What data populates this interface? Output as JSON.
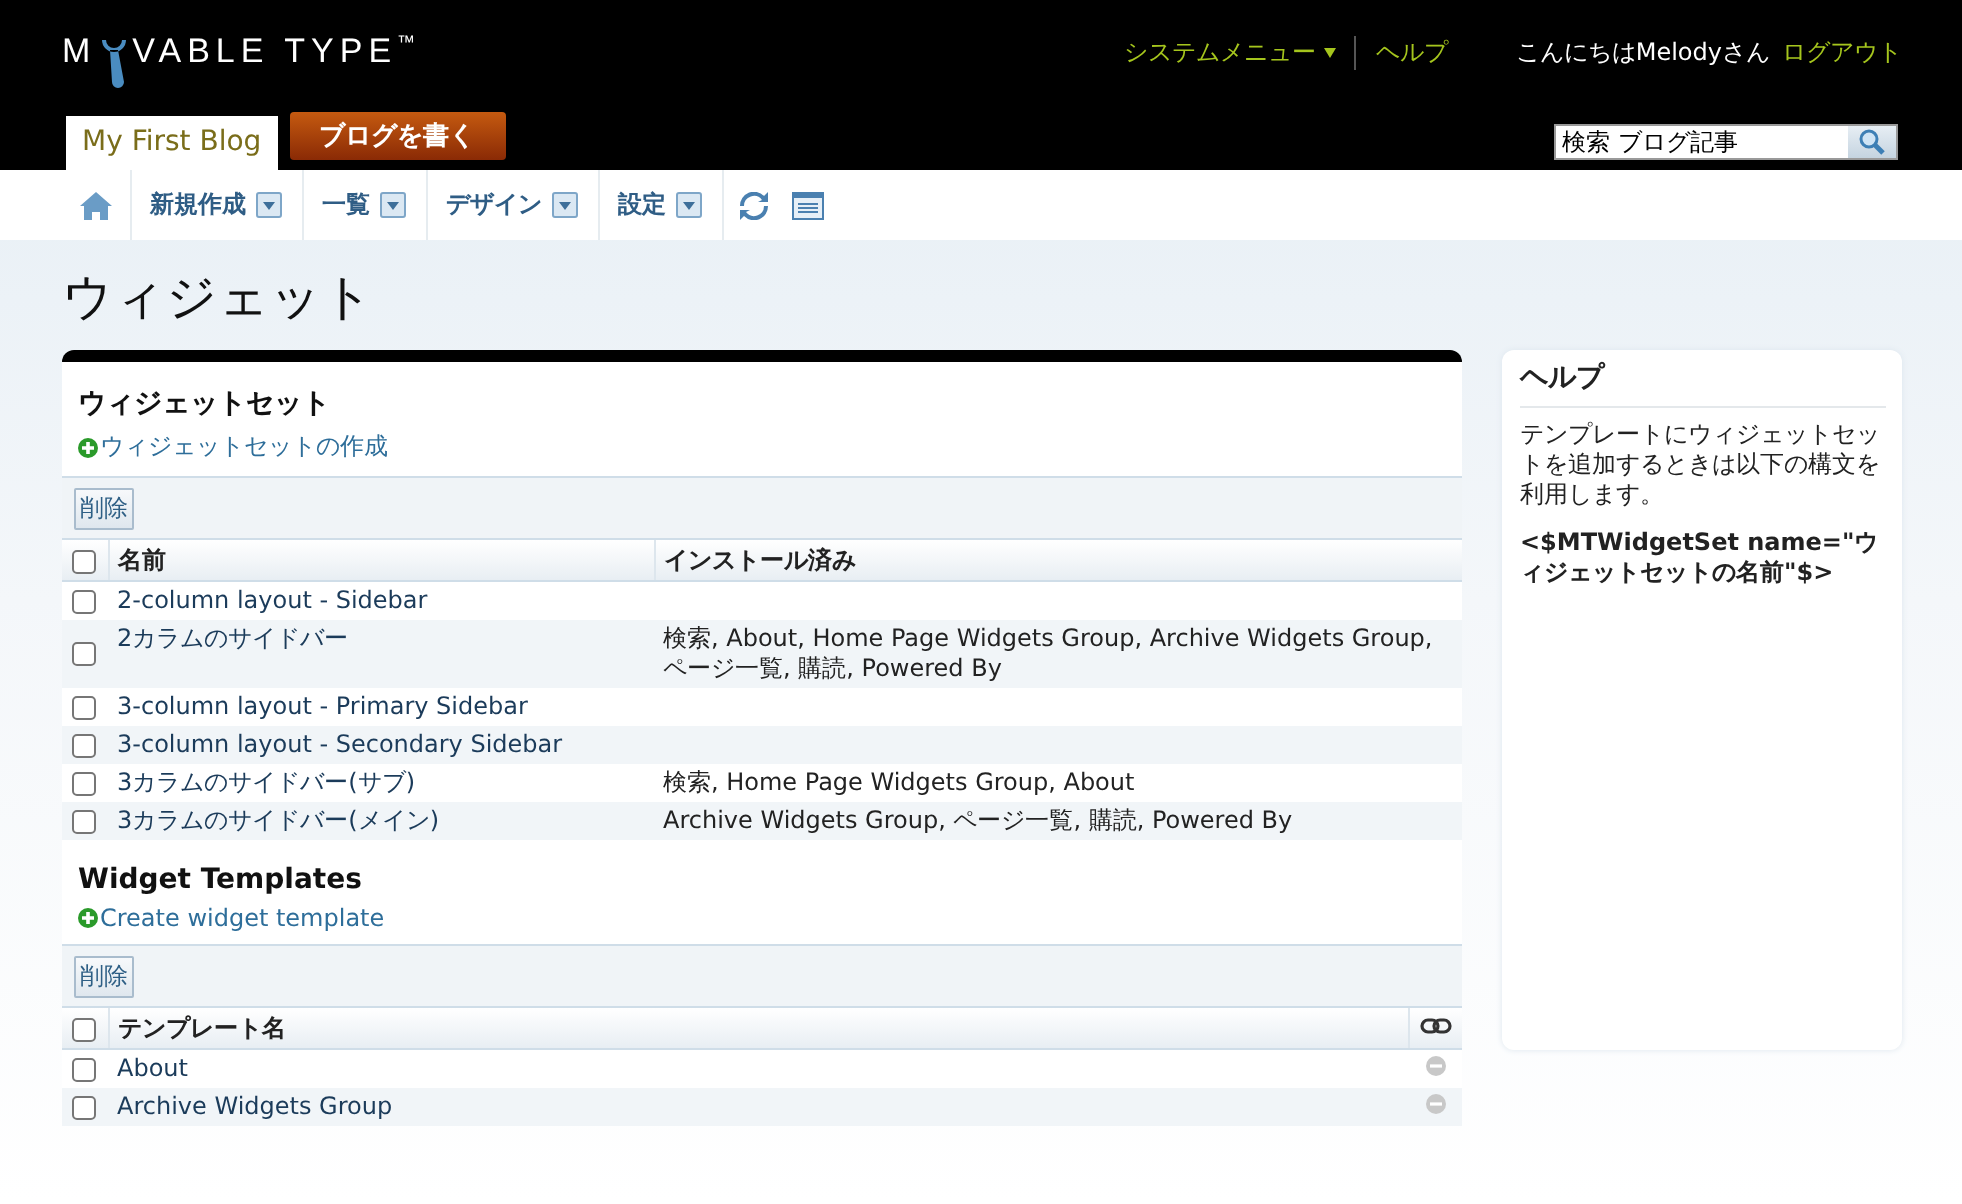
{
  "header": {
    "logo": {
      "before": "M",
      "after": "VABLE TYPE",
      "trademark": "™"
    },
    "system_menu": "システムメニュー",
    "help_link": "ヘルプ",
    "greeting": "こんにちはMelodyさん",
    "logout": "ログアウト",
    "blog_tab": {
      "label": "My First Blog",
      "selected": true
    },
    "write_button": "ブログを書く",
    "search": {
      "value": "検索 ブログ記事"
    }
  },
  "nav": [
    {
      "kind": "home"
    },
    {
      "kind": "menu",
      "label": "新規作成"
    },
    {
      "kind": "menu",
      "label": "一覧"
    },
    {
      "kind": "menu",
      "label": "デザイン"
    },
    {
      "kind": "menu",
      "label": "設定"
    },
    {
      "kind": "refresh"
    },
    {
      "kind": "view"
    }
  ],
  "page_title": "ウィジェット",
  "sections": [
    {
      "kind": "sets",
      "title": "ウィジェットセット",
      "create_link": "ウィジェットセットの作成",
      "delete_button": "削除",
      "columns": [
        "名前",
        "インストール済み"
      ],
      "header_checked": false,
      "rows": [
        {
          "name": "2-column layout - Sidebar",
          "installed": "",
          "checked": false
        },
        {
          "name": "2カラムのサイドバー",
          "installed": "検索, About, Home Page Widgets Group, Archive Widgets Group, ページ一覧, 購読, Powered By",
          "checked": false
        },
        {
          "name": "3-column layout - Primary Sidebar",
          "installed": "",
          "checked": false
        },
        {
          "name": "3-column layout - Secondary Sidebar",
          "installed": "",
          "checked": false
        },
        {
          "name": "3カラムのサイドバー(サブ)",
          "installed": "検索, Home Page Widgets Group, About",
          "checked": false
        },
        {
          "name": "3カラムのサイドバー(メイン)",
          "installed": "Archive Widgets Group, ページ一覧, 購読, Powered By",
          "checked": false
        }
      ]
    },
    {
      "kind": "templates",
      "title": "Widget Templates",
      "create_link": "Create widget template",
      "delete_button": "削除",
      "columns": [
        "テンプレート名"
      ],
      "header_checked": false,
      "rows": [
        {
          "name": "About",
          "checked": false,
          "linked": false
        },
        {
          "name": "Archive Widgets Group",
          "checked": false,
          "linked": false
        }
      ]
    }
  ],
  "help": {
    "title": "ヘルプ",
    "text": "テンプレートにウィジェットセットを追加するときは以下の構文を利用します。",
    "code": "<$MTWidgetSet name=\"ウィジェットセットの名前\"$>"
  }
}
